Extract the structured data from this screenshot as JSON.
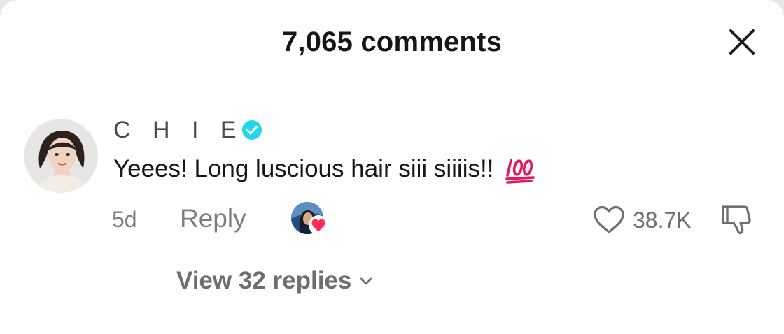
{
  "header": {
    "title": "7,065 comments"
  },
  "comment": {
    "username": "C H I E",
    "verified": true,
    "text": "Yeees! Long luscious hair siii siiiis!!",
    "emoji": "hundred-points-icon",
    "time": "5d",
    "reply_label": "Reply",
    "creator_liked": true,
    "like_count": "38.7K",
    "replies_label": "View 32 replies"
  },
  "colors": {
    "verified": "#20d5ec",
    "heart_badge": "#fe2c55",
    "muted_text": "#7d7d7d"
  }
}
